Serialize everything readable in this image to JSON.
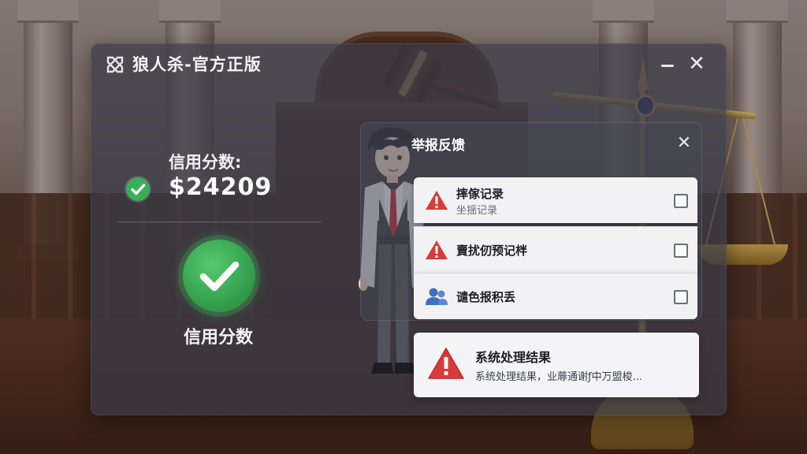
{
  "window": {
    "title": "狼人杀-官方正版"
  },
  "credit": {
    "heading": "信用分数:",
    "value": "$24209",
    "label": "信用分数"
  },
  "report": {
    "title": "举报反馈",
    "options": [
      {
        "icon": "warning-icon",
        "title": "摔傢记录",
        "subtitle": "坐揺记录",
        "checked": false
      },
      {
        "icon": "warning-icon",
        "title": "賣扰仞预记柈",
        "checked": false
      },
      {
        "icon": "users-icon",
        "title": "谴色报积丢",
        "checked": false
      }
    ]
  },
  "result": {
    "title": "系统处理结果",
    "description": "系统处理结果，业蓐通谢ƒ中万盟梭..."
  },
  "colors": {
    "success": "#3bae5a",
    "warning": "#d93a3a",
    "user_icon": "#3f6ec2"
  }
}
